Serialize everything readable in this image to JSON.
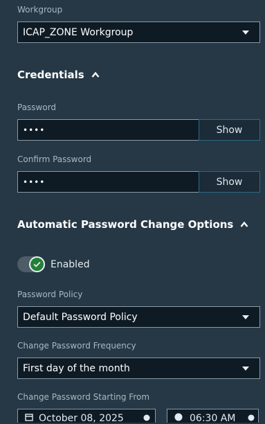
{
  "workgroup": {
    "label": "Workgroup",
    "value": "ICAP_ZONE Workgroup"
  },
  "credentials": {
    "title": "Credentials",
    "password": {
      "label": "Password",
      "value": "••••",
      "show_label": "Show"
    },
    "confirm_password": {
      "label": "Confirm Password",
      "value": "••••",
      "show_label": "Show"
    }
  },
  "auto_change": {
    "title": "Automatic Password Change Options",
    "toggle": {
      "label": "Enabled",
      "on": true
    },
    "policy": {
      "label": "Password Policy",
      "value": "Default Password Policy"
    },
    "frequency": {
      "label": "Change Password Frequency",
      "value": "First day of the month"
    },
    "starting_from": {
      "label": "Change Password Starting From",
      "date": "October 08, 2025",
      "time": "06:30 AM"
    }
  },
  "colors": {
    "background": "#263845",
    "field_bg": "#0e1b25",
    "toggle_on": "#23803a",
    "show_border": "#2b6a86"
  }
}
